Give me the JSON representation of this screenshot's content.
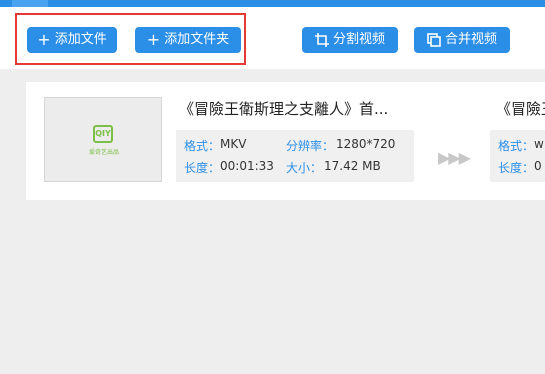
{
  "toolbar": {
    "add_file": "添加文件",
    "add_folder": "添加文件夹",
    "split_video": "分割视频",
    "merge_video": "合并视频"
  },
  "items": [
    {
      "title": "《冒險王衛斯理之支離人》首...",
      "format_label": "格式：",
      "format_value": "MKV",
      "resolution_label": "分辨率：",
      "resolution_value": "1280*720",
      "duration_label": "长度：",
      "duration_value": "00:01:33",
      "size_label": "大小：",
      "size_value": "17.42 MB",
      "thumb_logo": "QIY",
      "thumb_caption": "爱奇艺出品"
    },
    {
      "title": "《冒險王",
      "format_label": "格式：",
      "format_value": "w",
      "duration_label": "长度：",
      "duration_value": "0"
    }
  ],
  "colors": {
    "accent": "#2b8fe8",
    "highlight": "#e53935",
    "logo_green": "#7cc04a"
  }
}
